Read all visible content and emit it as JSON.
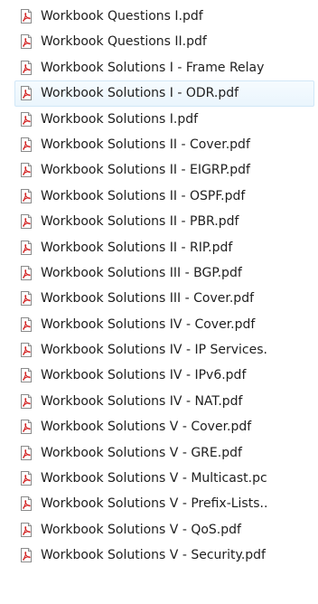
{
  "file_list": {
    "icon": "pdf-file-icon",
    "selected_index": 3,
    "items": [
      {
        "name": "Workbook Questions I.pdf"
      },
      {
        "name": "Workbook Questions II.pdf"
      },
      {
        "name": "Workbook Solutions I - Frame Relay"
      },
      {
        "name": "Workbook Solutions I - ODR.pdf"
      },
      {
        "name": "Workbook Solutions I.pdf"
      },
      {
        "name": "Workbook Solutions II - Cover.pdf"
      },
      {
        "name": "Workbook Solutions II - EIGRP.pdf"
      },
      {
        "name": "Workbook Solutions II - OSPF.pdf"
      },
      {
        "name": "Workbook Solutions II - PBR.pdf"
      },
      {
        "name": "Workbook Solutions II - RIP.pdf"
      },
      {
        "name": "Workbook Solutions III - BGP.pdf"
      },
      {
        "name": "Workbook Solutions III - Cover.pdf"
      },
      {
        "name": "Workbook Solutions IV - Cover.pdf"
      },
      {
        "name": "Workbook Solutions IV - IP Services."
      },
      {
        "name": "Workbook Solutions IV - IPv6.pdf"
      },
      {
        "name": "Workbook Solutions IV - NAT.pdf"
      },
      {
        "name": "Workbook Solutions V - Cover.pdf"
      },
      {
        "name": "Workbook Solutions V - GRE.pdf"
      },
      {
        "name": "Workbook Solutions V - Multicast.pc"
      },
      {
        "name": "Workbook Solutions V - Prefix-Lists.."
      },
      {
        "name": "Workbook Solutions V - QoS.pdf"
      },
      {
        "name": "Workbook Solutions V - Security.pdf"
      }
    ]
  },
  "colors": {
    "text": "#1e1e1e",
    "selection_bg": "#eaf5fd",
    "selection_border": "#d1e7f7",
    "pdf_red": "#d32222"
  }
}
